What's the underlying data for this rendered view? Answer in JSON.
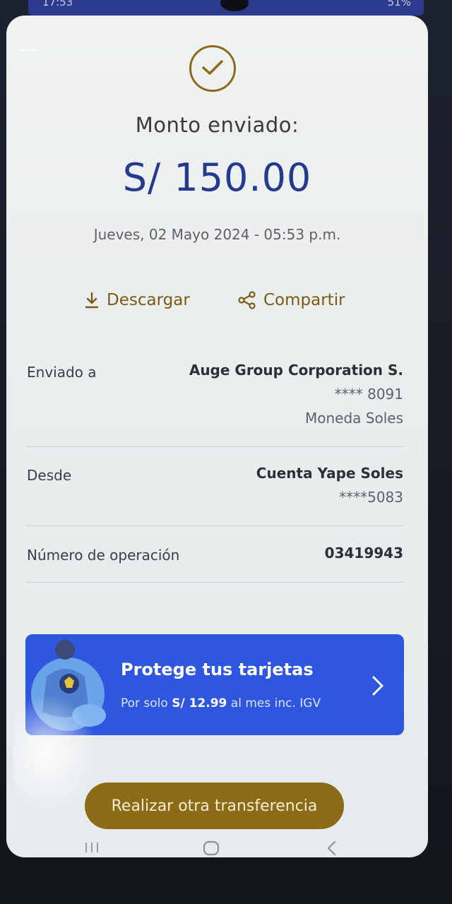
{
  "status_bar": {
    "time": "17:53",
    "battery": "51%"
  },
  "receipt": {
    "title": "Monto enviado:",
    "amount": "S/ 150.00",
    "datetime": "Jueves, 02 Mayo 2024 - 05:53 p.m."
  },
  "actions": {
    "download_label": "Descargar",
    "share_label": "Compartir"
  },
  "details": {
    "sent_to": {
      "label": "Enviado a",
      "name": "Auge Group Corporation S.",
      "account": "**** 8091",
      "currency": "Moneda Soles"
    },
    "from": {
      "label": "Desde",
      "account_name": "Cuenta Yape Soles",
      "account": "****5083"
    },
    "operation": {
      "label": "Número de operación",
      "number": "03419943"
    }
  },
  "promo": {
    "title": "Protege tus tarjetas",
    "sub_prefix": "Por solo ",
    "price": "S/ 12.99",
    "sub_suffix": " al mes inc. IGV"
  },
  "cta": {
    "label": "Realizar otra transferencia"
  },
  "icons": {
    "check": "check-icon",
    "download": "download-icon",
    "share": "share-icon",
    "chevron": "chevron-right-icon"
  },
  "colors": {
    "brand_blue": "#243a8e",
    "gold": "#8b6a1c",
    "promo_blue": "#2f56de"
  }
}
